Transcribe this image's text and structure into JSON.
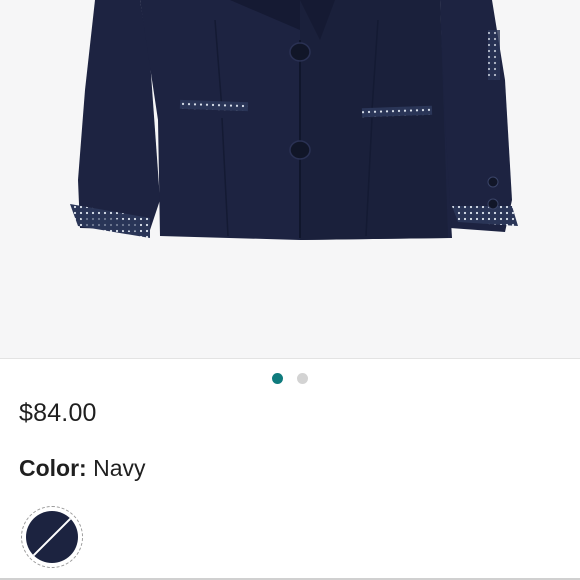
{
  "product": {
    "image_alt": "Navy blazer with polka-dot cuffs and pocket trim",
    "price": "$84.00"
  },
  "carousel": {
    "total": 2,
    "active_index": 0,
    "active_color": "#0f7b7d",
    "inactive_color": "#d3d3d3"
  },
  "color": {
    "label": "Color:",
    "value": "Navy",
    "swatch_color": "#1c2340"
  },
  "theme": {
    "blazer": "#1d2341",
    "blazer_shadow": "#141a33",
    "dot_fabric": "#2a3557",
    "dot_color": "#dfe6f0"
  }
}
